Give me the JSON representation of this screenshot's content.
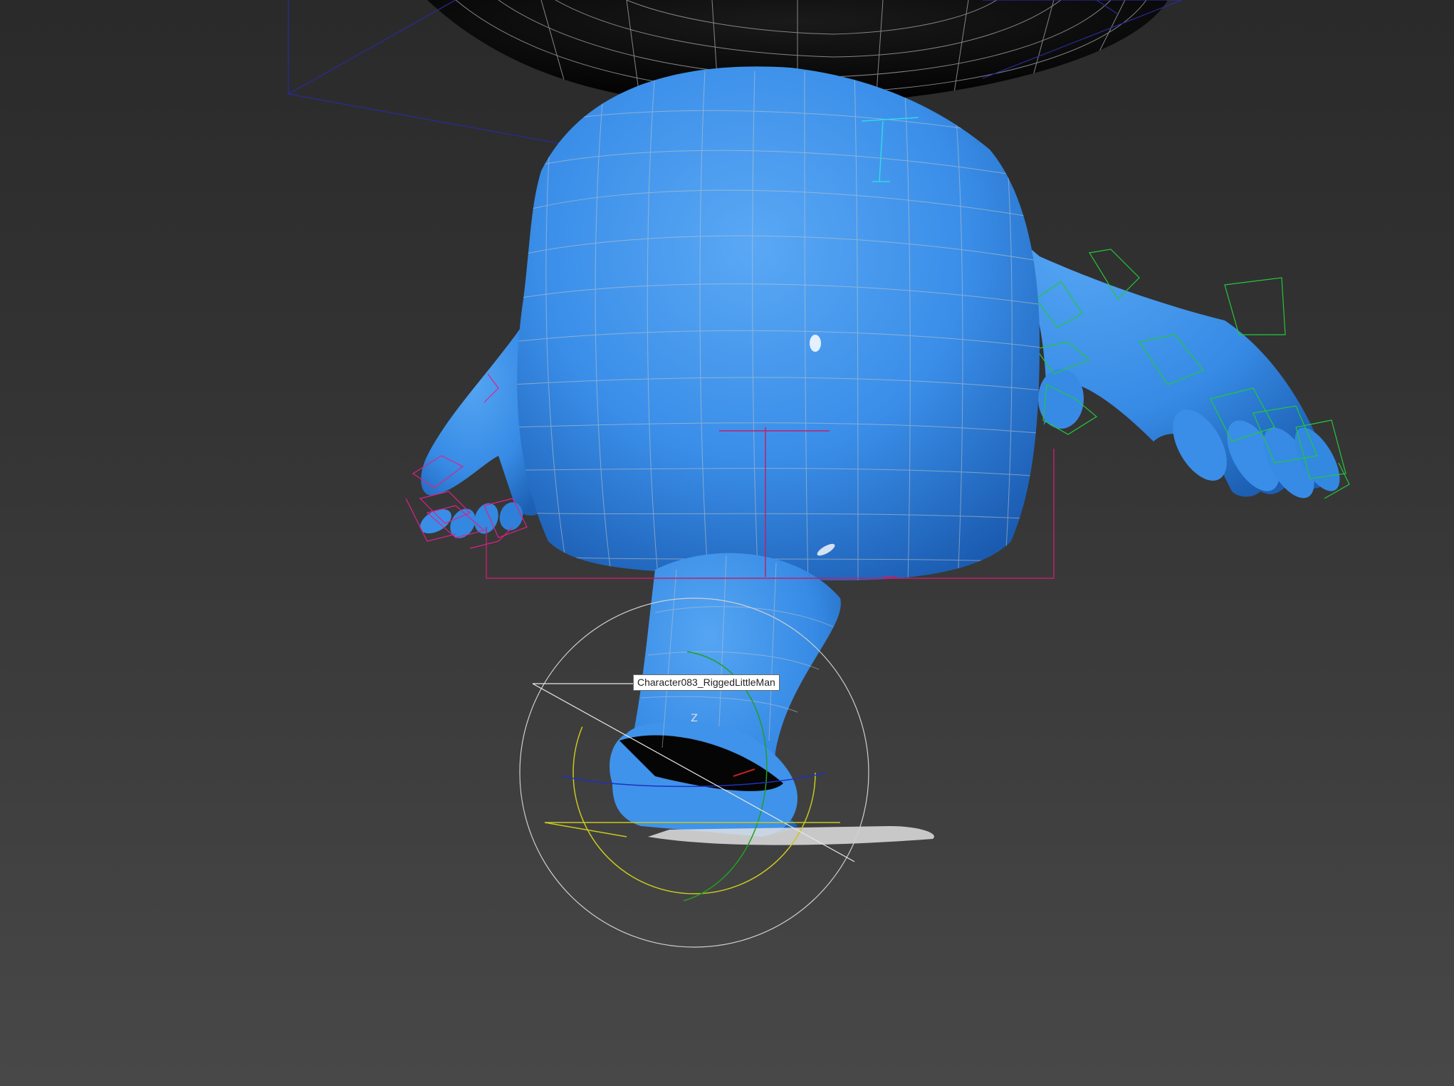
{
  "viewport": {
    "object_tooltip": "Character083_RiggedLittleMan",
    "gizmo_axis_label": "Z"
  },
  "colors": {
    "background_top": "#2a2a2a",
    "background_bottom": "#484848",
    "mesh_surface": "#3a8ee8",
    "mesh_wire": "#bfbfbf",
    "head_surface": "#050505",
    "right_hand_bones": "#22c83a",
    "left_hand_bones": "#e0208a",
    "spine_bone": "#c0206a",
    "shoulder_bone": "#2fd8e6",
    "rotate_gizmo_x": "#c8c820",
    "rotate_gizmo_y": "#20a020",
    "rotate_gizmo_z": "#2030c0",
    "transform_gizmo_outer": "#d0d0d0"
  }
}
